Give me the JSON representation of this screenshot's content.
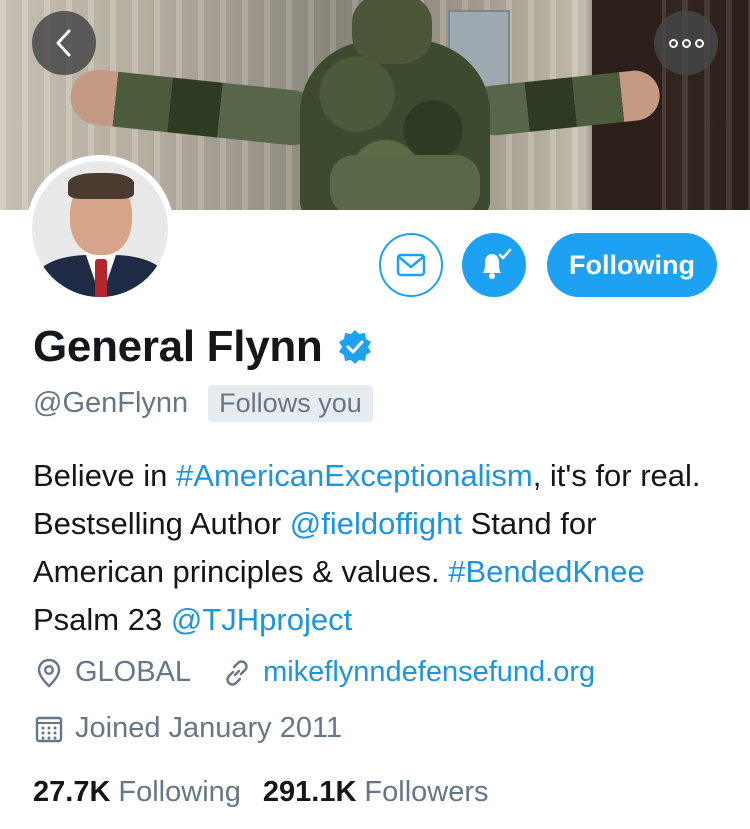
{
  "header": {
    "back_icon": "chevron-left-icon",
    "more_icon": "more-options-icon"
  },
  "profile": {
    "display_name": "General Flynn",
    "verified_icon": "verified-badge-icon",
    "handle": "@GenFlynn",
    "follows_you": "Follows you",
    "bio": {
      "t1": "Believe in ",
      "l1": "#AmericanExceptionalism",
      "t2": ", it's for real. Bestselling Author ",
      "l2": "@fieldoffight",
      "t3": " Stand for American principles & values. ",
      "l3": "#BendedKnee",
      "t4": " Psalm 23 ",
      "l4": "@TJHproject"
    },
    "location": "GLOBAL",
    "website": "mikeflynndefensefund.org",
    "joined": "Joined January 2011"
  },
  "actions": {
    "message_icon": "envelope-icon",
    "notify_icon": "bell-check-icon",
    "following_label": "Following"
  },
  "stats": {
    "following_count": "27.7K",
    "following_label": "Following",
    "followers_count": "291.1K",
    "followers_label": "Followers"
  },
  "colors": {
    "accent": "#1da1f2",
    "link": "#1b95e0",
    "secondary_text": "#657786",
    "primary_text": "#14171a"
  }
}
